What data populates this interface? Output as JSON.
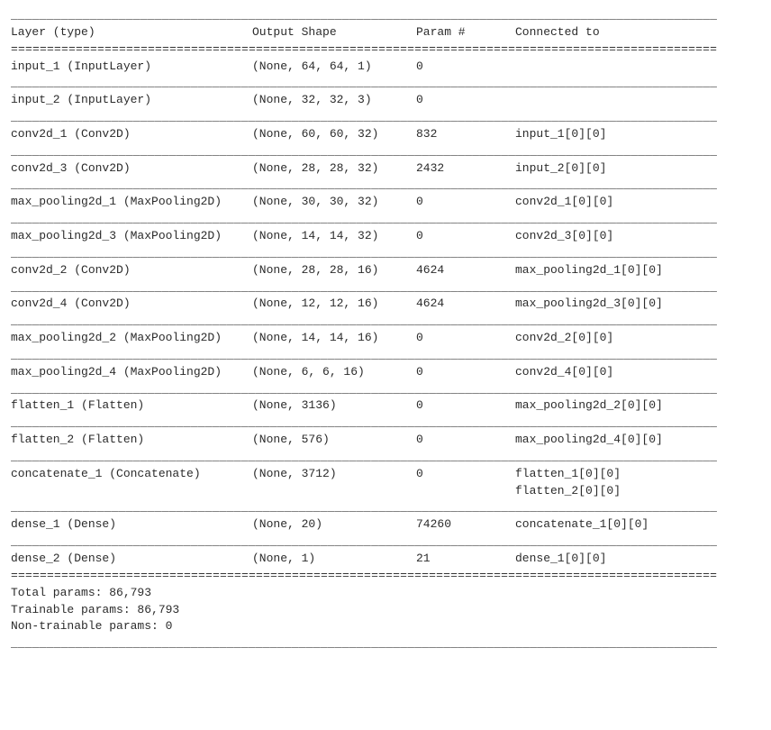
{
  "headers": {
    "layer": "Layer (type)",
    "shape": "Output Shape",
    "param": "Param #",
    "connected": "Connected to"
  },
  "separators": {
    "top": "__________________________________________________________________________________________________",
    "double": "==================================================================================================",
    "single": "__________________________________________________________________________________________________"
  },
  "rows": [
    {
      "layer": "input_1 (InputLayer)",
      "shape": "(None, 64, 64, 1)",
      "param": "0",
      "connected": [
        ""
      ]
    },
    {
      "layer": "input_2 (InputLayer)",
      "shape": "(None, 32, 32, 3)",
      "param": "0",
      "connected": [
        ""
      ]
    },
    {
      "layer": "conv2d_1 (Conv2D)",
      "shape": "(None, 60, 60, 32)",
      "param": "832",
      "connected": [
        "input_1[0][0]"
      ]
    },
    {
      "layer": "conv2d_3 (Conv2D)",
      "shape": "(None, 28, 28, 32)",
      "param": "2432",
      "connected": [
        "input_2[0][0]"
      ]
    },
    {
      "layer": "max_pooling2d_1 (MaxPooling2D)",
      "shape": "(None, 30, 30, 32)",
      "param": "0",
      "connected": [
        "conv2d_1[0][0]"
      ]
    },
    {
      "layer": "max_pooling2d_3 (MaxPooling2D)",
      "shape": "(None, 14, 14, 32)",
      "param": "0",
      "connected": [
        "conv2d_3[0][0]"
      ]
    },
    {
      "layer": "conv2d_2 (Conv2D)",
      "shape": "(None, 28, 28, 16)",
      "param": "4624",
      "connected": [
        "max_pooling2d_1[0][0]"
      ]
    },
    {
      "layer": "conv2d_4 (Conv2D)",
      "shape": "(None, 12, 12, 16)",
      "param": "4624",
      "connected": [
        "max_pooling2d_3[0][0]"
      ]
    },
    {
      "layer": "max_pooling2d_2 (MaxPooling2D)",
      "shape": "(None, 14, 14, 16)",
      "param": "0",
      "connected": [
        "conv2d_2[0][0]"
      ]
    },
    {
      "layer": "max_pooling2d_4 (MaxPooling2D)",
      "shape": "(None, 6, 6, 16)",
      "param": "0",
      "connected": [
        "conv2d_4[0][0]"
      ]
    },
    {
      "layer": "flatten_1 (Flatten)",
      "shape": "(None, 3136)",
      "param": "0",
      "connected": [
        "max_pooling2d_2[0][0]"
      ]
    },
    {
      "layer": "flatten_2 (Flatten)",
      "shape": "(None, 576)",
      "param": "0",
      "connected": [
        "max_pooling2d_4[0][0]"
      ]
    },
    {
      "layer": "concatenate_1 (Concatenate)",
      "shape": "(None, 3712)",
      "param": "0",
      "connected": [
        "flatten_1[0][0]",
        "flatten_2[0][0]"
      ]
    },
    {
      "layer": "dense_1 (Dense)",
      "shape": "(None, 20)",
      "param": "74260",
      "connected": [
        "concatenate_1[0][0]"
      ]
    },
    {
      "layer": "dense_2 (Dense)",
      "shape": "(None, 1)",
      "param": "21",
      "connected": [
        "dense_1[0][0]"
      ]
    }
  ],
  "footer": {
    "total": "Total params: 86,793",
    "trainable": "Trainable params: 86,793",
    "nontrainable": "Non-trainable params: 0"
  }
}
